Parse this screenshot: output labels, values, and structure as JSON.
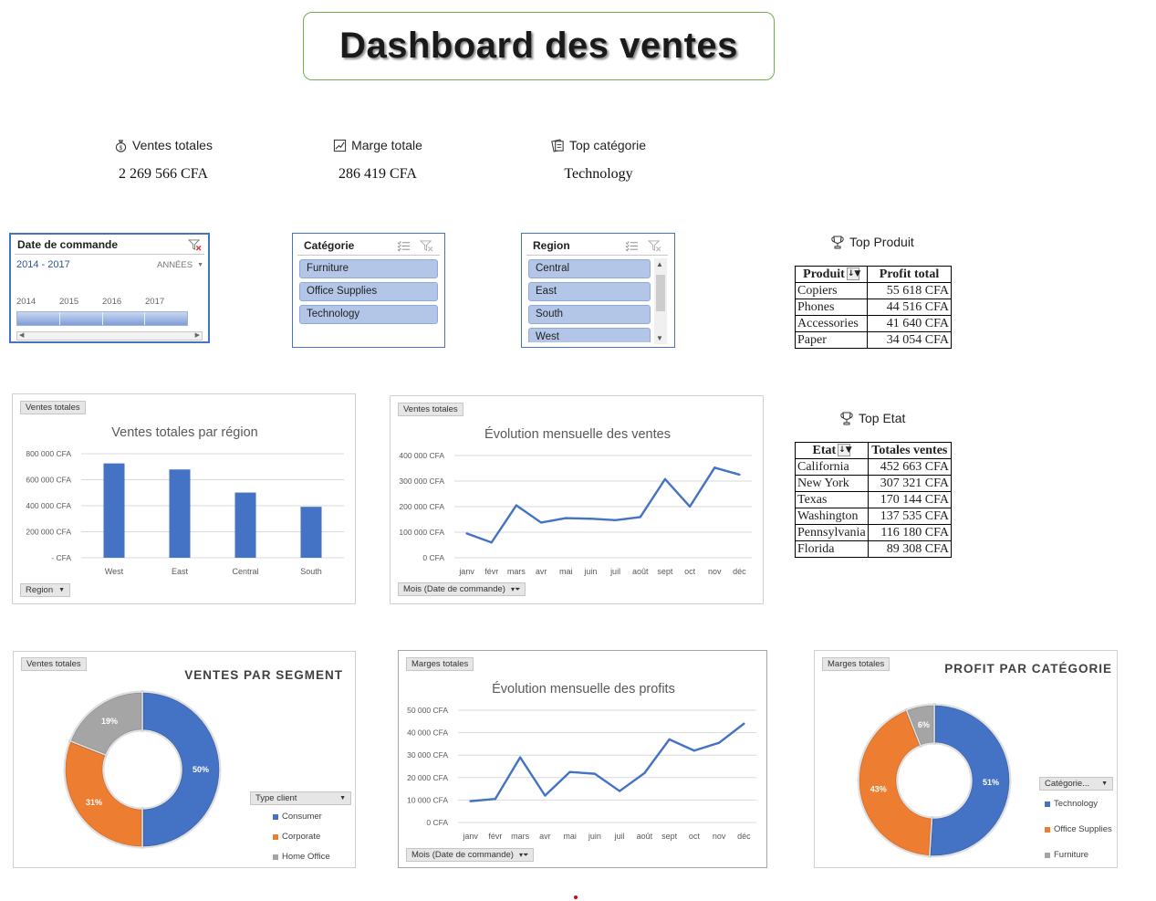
{
  "title": "Dashboard des ventes",
  "kpis": [
    {
      "label": "Ventes totales",
      "value": "2 269 566 CFA",
      "icon": "money-bag-icon"
    },
    {
      "label": "Marge totale",
      "value": "286 419 CFA",
      "icon": "chart-up-icon"
    },
    {
      "label": "Top catégorie",
      "value": "Technology",
      "icon": "clipboard-icon"
    }
  ],
  "slicers": {
    "date": {
      "title": "Date de commande",
      "range": "2014 - 2017",
      "period": "ANNÉES",
      "years": [
        "2014",
        "2015",
        "2016",
        "2017"
      ]
    },
    "categorie": {
      "title": "Catégorie",
      "items": [
        "Furniture",
        "Office Supplies",
        "Technology"
      ]
    },
    "region": {
      "title": "Region",
      "items": [
        "Central",
        "East",
        "South",
        "West"
      ]
    }
  },
  "top_produit": {
    "heading": "Top Produit",
    "headers": [
      "Produit",
      "Profit total"
    ],
    "rows": [
      [
        "Copiers",
        "55 618 CFA"
      ],
      [
        "Phones",
        "44 516 CFA"
      ],
      [
        "Accessories",
        "41 640 CFA"
      ],
      [
        "Paper",
        "34 054 CFA"
      ]
    ]
  },
  "top_etat": {
    "heading": "Top Etat",
    "headers": [
      "Etat",
      "Totales ventes"
    ],
    "rows": [
      [
        "California",
        "452 663 CFA"
      ],
      [
        "New York",
        "307 321 CFA"
      ],
      [
        "Texas",
        "170 144 CFA"
      ],
      [
        "Washington",
        "137 535 CFA"
      ],
      [
        "Pennsylvania",
        "116 180 CFA"
      ],
      [
        "Florida",
        "89 308 CFA"
      ]
    ]
  },
  "panels": {
    "region": {
      "tag": "Ventes totales",
      "dropdown": "Region"
    },
    "monthly_sales": {
      "tag": "Ventes totales",
      "dropdown": "Mois (Date de commande)"
    },
    "segment": {
      "tag": "Ventes totales",
      "dropdown": "Type client"
    },
    "monthly_profit": {
      "tag": "Marges totales",
      "dropdown": "Mois (Date de commande)"
    },
    "category": {
      "tag": "Marges totales",
      "dropdown": "Catégorie..."
    }
  },
  "colors": {
    "blue": "#4472c4",
    "orange": "#ed7d31",
    "gray": "#a5a5a5",
    "title_border": "#6fae4f"
  },
  "chart_data": [
    {
      "id": "region",
      "type": "bar",
      "title": "Ventes totales par région",
      "categories": [
        "West",
        "East",
        "Central",
        "South"
      ],
      "values": [
        725458,
        678781,
        501240,
        391722
      ],
      "ylim": [
        0,
        800000
      ],
      "yticks": [
        0,
        200000,
        400000,
        600000,
        800000
      ],
      "ytick_labels": [
        "- CFA",
        "200 000 CFA",
        "400 000 CFA",
        "600 000 CFA",
        "800 000 CFA"
      ],
      "grid": true
    },
    {
      "id": "monthly_sales",
      "type": "line",
      "title": "Évolution mensuelle des ventes",
      "categories": [
        "janv",
        "févr",
        "mars",
        "avr",
        "mai",
        "juin",
        "juil",
        "août",
        "sept",
        "oct",
        "nov",
        "déc"
      ],
      "values": [
        94925,
        59751,
        205005,
        137762,
        155029,
        152718,
        147238,
        159044,
        307650,
        200323,
        352461,
        325293
      ],
      "ylim": [
        0,
        400000
      ],
      "yticks": [
        0,
        100000,
        200000,
        300000,
        400000
      ],
      "ytick_labels": [
        "0 CFA",
        "100 000 CFA",
        "200 000 CFA",
        "300 000 CFA",
        "400 000 CFA"
      ],
      "grid": true
    },
    {
      "id": "segment",
      "type": "pie",
      "title": "VENTES PAR SEGMENT",
      "series": [
        {
          "name": "Consumer",
          "value": 50,
          "label": "50%"
        },
        {
          "name": "Corporate",
          "value": 31,
          "label": "31%"
        },
        {
          "name": "Home Office",
          "value": 19,
          "label": "19%"
        }
      ],
      "legend": "right"
    },
    {
      "id": "monthly_profit",
      "type": "line",
      "title": "Évolution mensuelle des profits",
      "categories": [
        "janv",
        "févr",
        "mars",
        "avr",
        "mai",
        "juin",
        "juil",
        "août",
        "sept",
        "oct",
        "nov",
        "déc"
      ],
      "values": [
        9500,
        10500,
        29000,
        12000,
        22500,
        21700,
        14000,
        22000,
        37000,
        32000,
        35500,
        44000
      ],
      "ylim": [
        0,
        50000
      ],
      "yticks": [
        0,
        10000,
        20000,
        30000,
        40000,
        50000
      ],
      "ytick_labels": [
        "0 CFA",
        "10 000 CFA",
        "20 000 CFA",
        "30 000 CFA",
        "40 000 CFA",
        "50 000 CFA"
      ],
      "grid": true
    },
    {
      "id": "category",
      "type": "pie",
      "title": "PROFIT PAR CATÉGORIE",
      "series": [
        {
          "name": "Technology",
          "value": 51,
          "label": "51%"
        },
        {
          "name": "Office Supplies",
          "value": 43,
          "label": "43%"
        },
        {
          "name": "Furniture",
          "value": 6,
          "label": "6%"
        }
      ],
      "legend": "right"
    }
  ]
}
